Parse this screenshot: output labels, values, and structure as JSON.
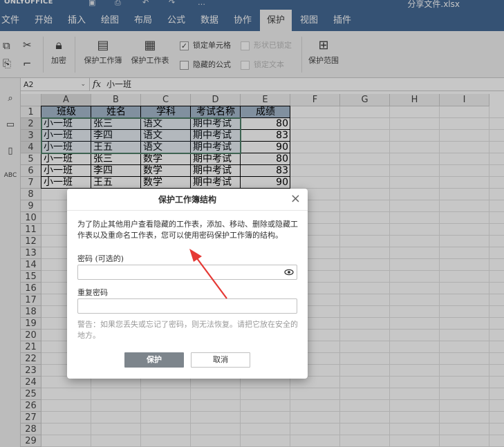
{
  "app": {
    "logo": "ONLYOFFICE",
    "filename": "分享文件.xlsx"
  },
  "tabs": [
    "文件",
    "开始",
    "插入",
    "绘图",
    "布局",
    "公式",
    "数据",
    "协作",
    "保护",
    "视图",
    "插件"
  ],
  "active_tab": "保护",
  "toolbar": {
    "encrypt": "加密",
    "protect_workbook": "保护工作簿",
    "protect_sheet": "保护工作表",
    "locked_cell": "锁定单元格",
    "shape_locked": "形状已锁定",
    "hidden_formula": "隐藏的公式",
    "lock_text": "锁定文本",
    "protect_range": "保护范围"
  },
  "formula_bar": {
    "cell_ref": "A2",
    "fx": "fx",
    "value": "小一班"
  },
  "columns": [
    "A",
    "B",
    "C",
    "D",
    "E",
    "F",
    "G",
    "H",
    "I"
  ],
  "rows": [
    "1",
    "2",
    "3",
    "4",
    "5",
    "6",
    "7",
    "8",
    "9",
    "10",
    "11",
    "12",
    "13",
    "14",
    "15",
    "16",
    "17",
    "18",
    "19",
    "20",
    "21",
    "22",
    "23",
    "24",
    "25",
    "26",
    "27",
    "28",
    "29"
  ],
  "table": {
    "headers": [
      "班级",
      "姓名",
      "学科",
      "考试名称",
      "成绩"
    ],
    "rows": [
      [
        "小一班",
        "张三",
        "语文",
        "期中考试",
        "80"
      ],
      [
        "小一班",
        "李四",
        "语文",
        "期中考试",
        "83"
      ],
      [
        "小一班",
        "王五",
        "语文",
        "期中考试",
        "90"
      ],
      [
        "小一班",
        "张三",
        "数学",
        "期中考试",
        "80"
      ],
      [
        "小一班",
        "李四",
        "数学",
        "期中考试",
        "83"
      ],
      [
        "小一班",
        "王五",
        "数学",
        "期中考试",
        "90"
      ]
    ]
  },
  "dialog": {
    "title": "保护工作簿结构",
    "close": "×",
    "description": "为了防止其他用户查看隐藏的工作表，添加、移动、删除或隐藏工作表以及重命名工作表，您可以使用密码保护工作簿的结构。",
    "password_label": "密码 (可选的)",
    "password_value": "",
    "repeat_label": "重复密码",
    "repeat_value": "",
    "warning": "警告：如果您丢失或忘记了密码，则无法恢复。请把它放在安全的地方。",
    "ok": "保护",
    "cancel": "取消"
  },
  "colors": {
    "header_bar": "#446995",
    "selection": "#4f7f68",
    "arrow": "#e53935"
  }
}
